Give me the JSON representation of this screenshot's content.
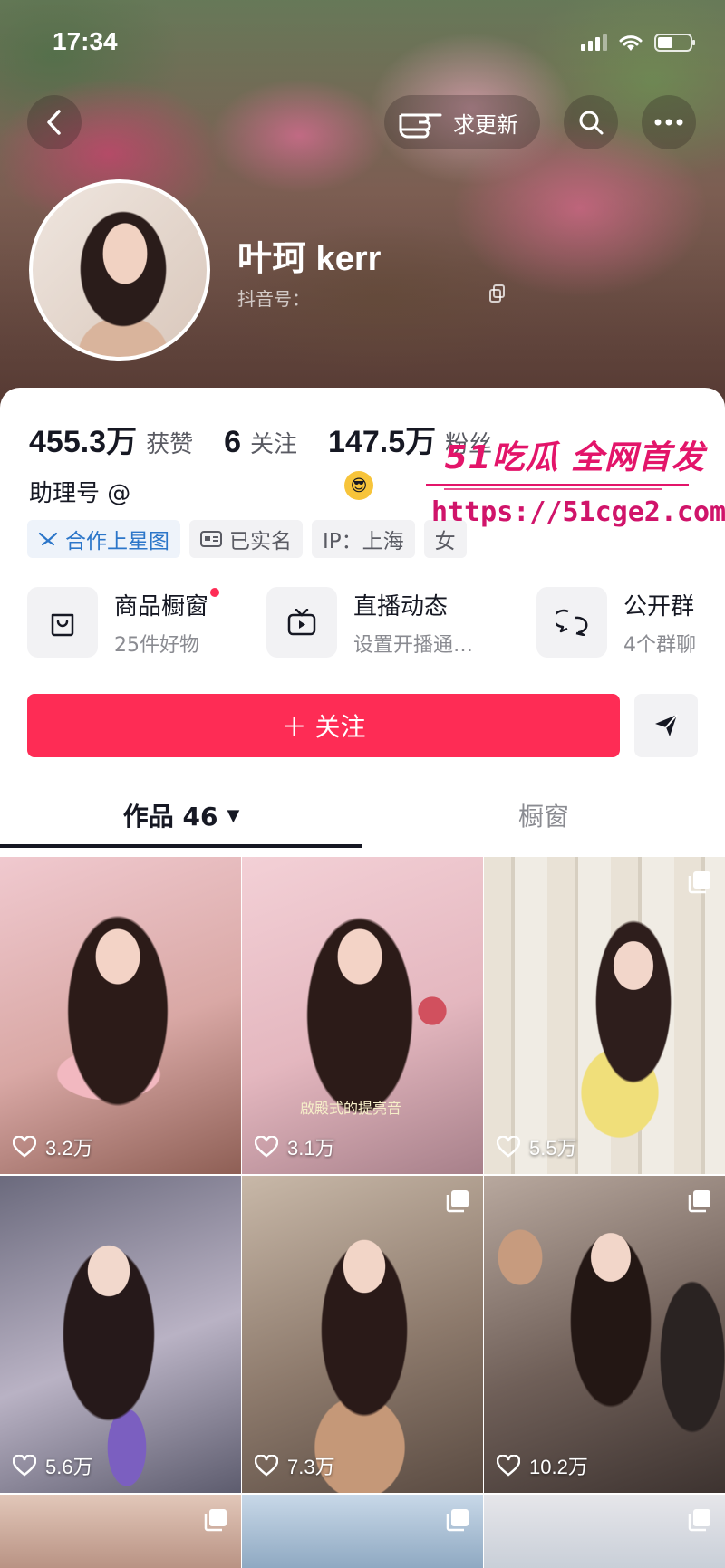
{
  "status_bar": {
    "time": "17:34"
  },
  "header": {
    "update_label": "求更新",
    "user_name": "叶珂 kerr",
    "douyin_id_label": "抖音号："
  },
  "stats": [
    {
      "value": "455.3万",
      "label": "获赞"
    },
    {
      "value": "6",
      "label": "关注"
    },
    {
      "value": "147.5万",
      "label": "粉丝"
    }
  ],
  "watermark": {
    "title": "51吃瓜 全网首发",
    "url": "https://51cge2.com"
  },
  "assistant": {
    "label": "助理号 @"
  },
  "tags": [
    {
      "label": "合作上星图",
      "icon": "star-map-icon"
    },
    {
      "label": "已实名",
      "icon": "id-card-icon"
    },
    {
      "label": "IP：上海",
      "icon": ""
    },
    {
      "label": "女",
      "icon": ""
    }
  ],
  "shortcuts": [
    {
      "title": "商品橱窗",
      "sub": "25件好物",
      "icon": "shop-bag-icon"
    },
    {
      "title": "直播动态",
      "sub": "设置开播通…",
      "icon": "tv-icon"
    },
    {
      "title": "公开群",
      "sub": "4个群聊",
      "icon": "chat-group-icon"
    }
  ],
  "follow_label": "＋ 关注",
  "tabs": {
    "works": "作品 46",
    "shop": "橱窗"
  },
  "videos": [
    {
      "likes": "3.2万",
      "multi": false
    },
    {
      "likes": "3.1万",
      "multi": false,
      "caption": "啟殿式的提亮音"
    },
    {
      "likes": "5.5万",
      "multi": true
    },
    {
      "likes": "5.6万",
      "multi": false
    },
    {
      "likes": "7.3万",
      "multi": true
    },
    {
      "likes": "10.2万",
      "multi": true
    },
    {
      "likes": "",
      "multi": true
    },
    {
      "likes": "",
      "multi": true
    },
    {
      "likes": "",
      "multi": true
    }
  ],
  "colors": {
    "accent": "#fe2c55",
    "text": "#161823",
    "secondary": "#8a8b91",
    "watermark": "#e3156a"
  }
}
